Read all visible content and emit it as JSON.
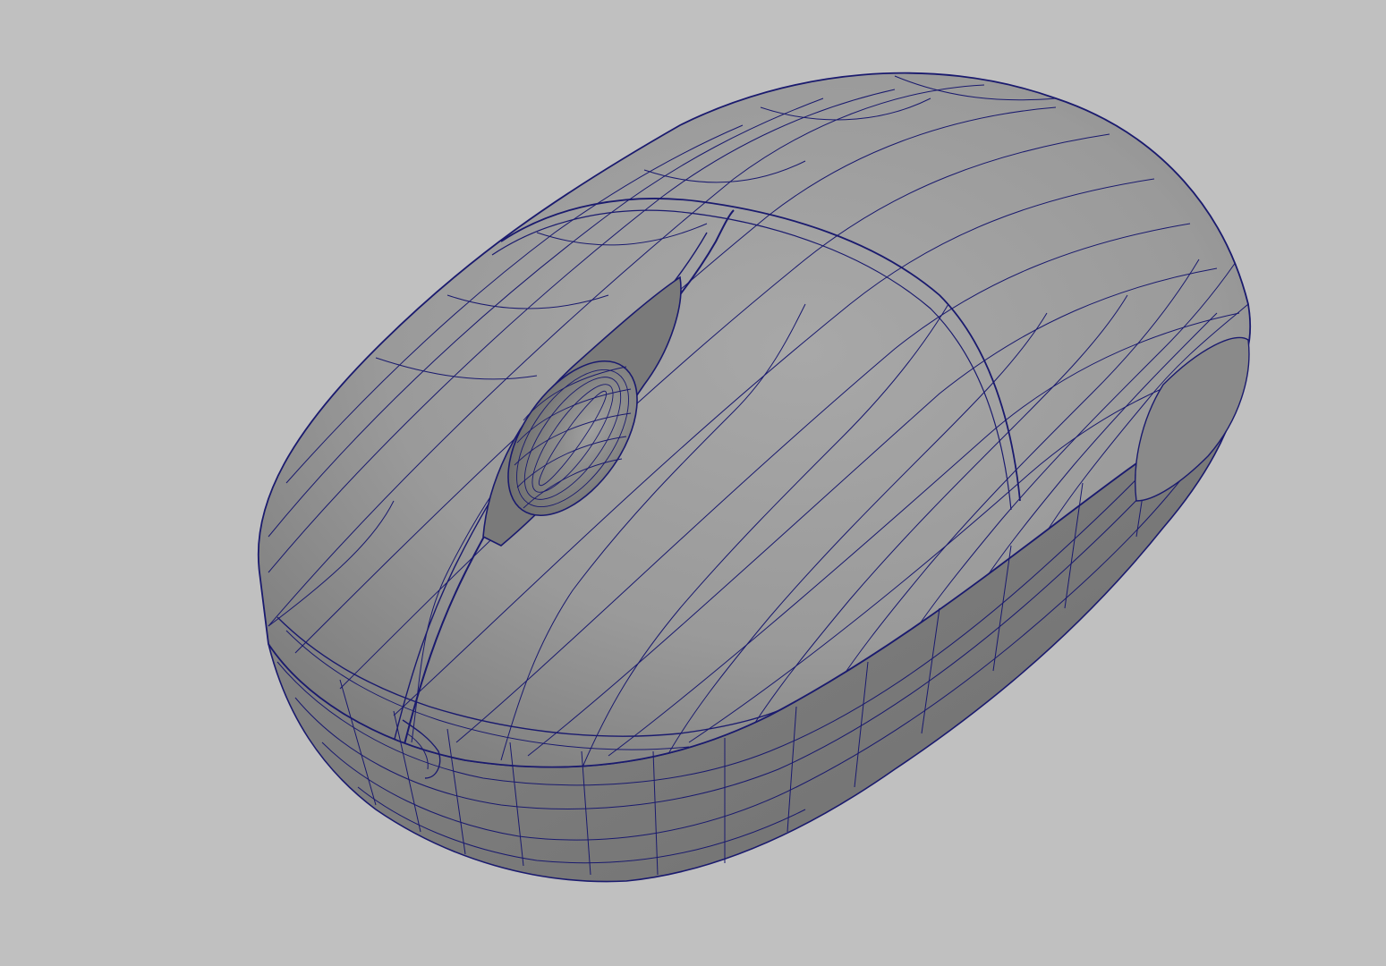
{
  "viewport": {
    "background_color": "#c0c0c0",
    "wireframe_color": "#1a1a6e",
    "shaded_surface_color": "#9a9a9a",
    "display_mode": "shaded-with-wireframe-on-shaded",
    "model": "computer-mouse-mesh"
  }
}
